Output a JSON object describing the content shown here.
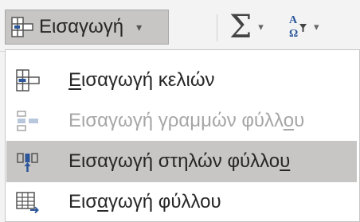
{
  "ribbon": {
    "insert_button": {
      "label": "Εισαγωγή",
      "icon": "insert-cells-icon",
      "arrow": "▾"
    },
    "sum_button": {
      "symbol": "Σ",
      "icon": "autosum-icon",
      "arrow": "▾"
    },
    "sort_button": {
      "icon": "sort-filter-icon",
      "arrow": "▾"
    }
  },
  "menu": {
    "items": [
      {
        "pre": "",
        "key": "Ε",
        "post": "ισαγωγή κελιών",
        "icon": "insert-cells-icon",
        "enabled": true,
        "highlighted": false
      },
      {
        "pre": "Εισαγωγή γραμμών φύλλ",
        "key": "ο",
        "post": "υ",
        "icon": "insert-sheet-rows-icon",
        "enabled": false,
        "highlighted": false
      },
      {
        "pre": "Εισαγωγή στηλών φύλλο",
        "key": "υ",
        "post": "",
        "icon": "insert-sheet-columns-icon",
        "enabled": true,
        "highlighted": true
      },
      {
        "pre": "Εισ",
        "key": "α",
        "post": "γωγή φύλλου",
        "icon": "insert-sheet-icon",
        "enabled": true,
        "highlighted": false
      }
    ]
  },
  "colors": {
    "ribbon_bg": "#f3f3f3",
    "highlight": "#c8c6c4",
    "text": "#262626",
    "disabled_text": "#a6a6a6",
    "icon_blue": "#2b579a"
  }
}
